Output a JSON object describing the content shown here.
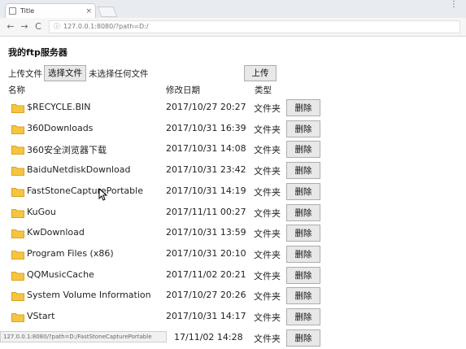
{
  "browser": {
    "tab_title": "Title",
    "tab_close": "×",
    "window_menu": "⋮",
    "url": "127.0.0.1:8080/?path=D:/"
  },
  "page": {
    "title": "我的ftp服务器",
    "upload_label": "上传文件",
    "choose_button": "选择文件",
    "no_file_text": "未选择任何文件",
    "upload_button": "上传",
    "headers": {
      "name": "名称",
      "date": "修改日期",
      "type": "类型"
    },
    "delete_label": "删除"
  },
  "files": [
    {
      "name": "$RECYCLE.BIN",
      "date": "2017/10/27 20:27",
      "type": "文件夹"
    },
    {
      "name": "360Downloads",
      "date": "2017/10/31 16:39",
      "type": "文件夹"
    },
    {
      "name": "360安全浏览器下载",
      "date": "2017/10/31 14:08",
      "type": "文件夹"
    },
    {
      "name": "BaiduNetdiskDownload",
      "date": "2017/10/31 23:42",
      "type": "文件夹"
    },
    {
      "name": "FastStoneCapturePortable",
      "date": "2017/10/31 14:19",
      "type": "文件夹"
    },
    {
      "name": "KuGou",
      "date": "2017/11/11 00:27",
      "type": "文件夹"
    },
    {
      "name": "KwDownload",
      "date": "2017/10/31 13:59",
      "type": "文件夹"
    },
    {
      "name": "Program Files (x86)",
      "date": "2017/10/31 20:10",
      "type": "文件夹"
    },
    {
      "name": "QQMusicCache",
      "date": "2017/11/02 20:21",
      "type": "文件夹"
    },
    {
      "name": "System Volume Information",
      "date": "2017/10/27 20:26",
      "type": "文件夹"
    },
    {
      "name": "VStart",
      "date": "2017/10/31 14:17",
      "type": "文件夹"
    },
    {
      "name": "",
      "date": "17/11/02 14:28",
      "type": "文件夹"
    }
  ],
  "status_bar_url": "127.0.0.1:8080/?path=D:/FastStoneCapturePortable",
  "colors": {
    "folder": "#f5c542",
    "folder_dark": "#d9a520"
  }
}
